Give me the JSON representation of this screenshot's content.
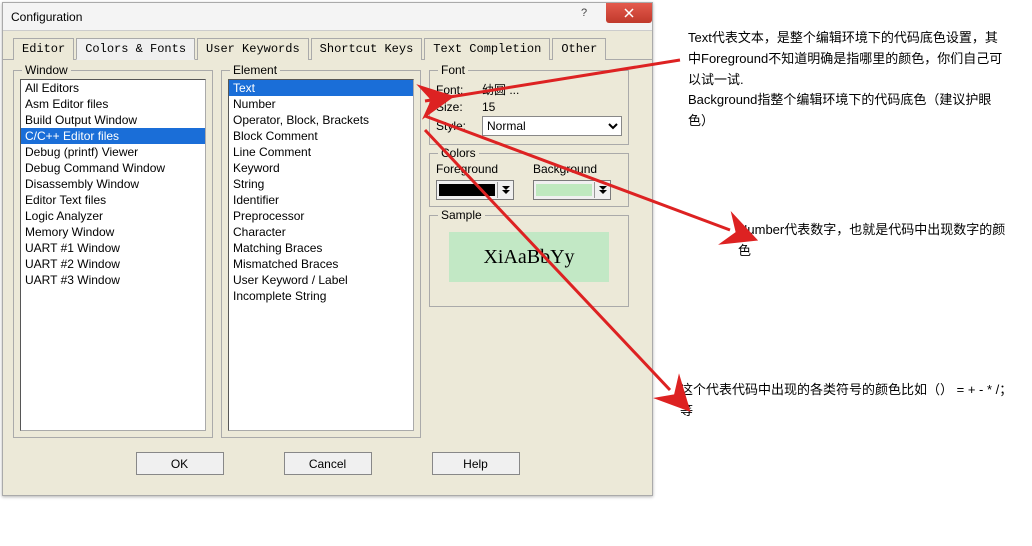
{
  "dialog": {
    "title": "Configuration",
    "tabs": [
      "Editor",
      "Colors & Fonts",
      "User Keywords",
      "Shortcut Keys",
      "Text Completion",
      "Other"
    ],
    "active_tab": 1,
    "window_group": {
      "label": "Window",
      "items": [
        "All Editors",
        "Asm Editor files",
        "Build Output Window",
        "C/C++ Editor files",
        "Debug (printf) Viewer",
        "Debug Command Window",
        "Disassembly Window",
        "Editor Text files",
        "Logic Analyzer",
        "Memory Window",
        "UART #1 Window",
        "UART #2 Window",
        "UART #3 Window"
      ],
      "selected_index": 3
    },
    "element_group": {
      "label": "Element",
      "items": [
        "Text",
        "Number",
        "Operator, Block, Brackets",
        "Block Comment",
        "Line Comment",
        "Keyword",
        "String",
        "Identifier",
        "Preprocessor",
        "Character",
        "Matching Braces",
        "Mismatched Braces",
        "User Keyword / Label",
        "Incomplete String"
      ],
      "selected_index": 0
    },
    "font_group": {
      "label": "Font",
      "font_label": "Font:",
      "font_value": "幼圆 ...",
      "size_label": "Size:",
      "size_value": "15",
      "style_label": "Style:",
      "style_value": "Normal"
    },
    "colors_group": {
      "label": "Colors",
      "foreground_label": "Foreground",
      "background_label": "Background"
    },
    "sample_group": {
      "label": "Sample",
      "text": "XiAaBbYy"
    },
    "buttons": {
      "ok": "OK",
      "cancel": "Cancel",
      "help": "Help"
    }
  },
  "annotations": {
    "a1": "Text代表文本，是整个编辑环境下的代码底色设置，其中Foreground不知道明确是指哪里的颜色，你们自己可以试一试.\nBackground指整个编辑环境下的代码底色（建议护眼色）",
    "a2": "Number代表数字，也就是代码中出现数字的颜色",
    "a3": "这个代表代码中出现的各类符号的颜色比如（）  =    +  - * /；  等"
  }
}
